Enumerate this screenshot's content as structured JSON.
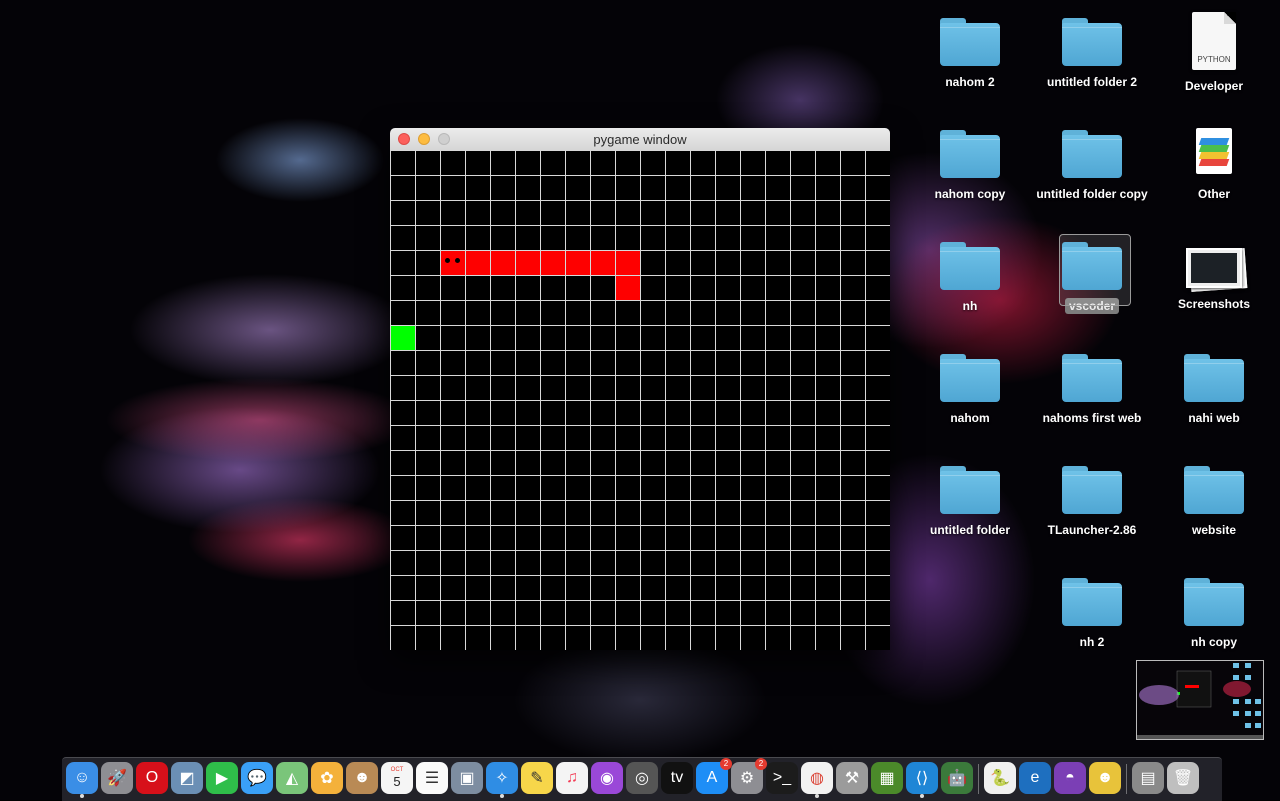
{
  "window": {
    "title": "pygame window"
  },
  "game": {
    "grid_columns": 20,
    "grid_rows": 20,
    "snake_color": "#fe0000",
    "food_color": "#00ff00",
    "grid_line_color": "#d8d8d8",
    "board_background": "#000000",
    "snake_segments": [
      [
        2,
        4
      ],
      [
        3,
        4
      ],
      [
        4,
        4
      ],
      [
        5,
        4
      ],
      [
        6,
        4
      ],
      [
        7,
        4
      ],
      [
        8,
        4
      ],
      [
        9,
        4
      ],
      [
        9,
        5
      ]
    ],
    "snake_head": [
      2,
      4
    ],
    "food": [
      0,
      7
    ]
  },
  "desktop": {
    "icons": [
      {
        "label": "nahom 2",
        "type": "folder"
      },
      {
        "label": "untitled folder 2",
        "type": "folder"
      },
      {
        "label": "Developer",
        "type": "document",
        "doc_text": "PYTHON"
      },
      {
        "label": "nahom copy",
        "type": "folder"
      },
      {
        "label": "untitled folder copy",
        "type": "folder"
      },
      {
        "label": "Other",
        "type": "stack"
      },
      {
        "label": "nh",
        "type": "folder"
      },
      {
        "label": "vscoder",
        "type": "folder",
        "selected": true
      },
      {
        "label": "Screenshots",
        "type": "screenshots"
      },
      {
        "label": "nahom",
        "type": "folder"
      },
      {
        "label": "nahoms first web",
        "type": "folder"
      },
      {
        "label": "nahi web",
        "type": "folder"
      },
      {
        "label": "untitled folder",
        "type": "folder"
      },
      {
        "label": "TLauncher-2.86",
        "type": "folder"
      },
      {
        "label": "website",
        "type": "folder"
      },
      {
        "label": "nh 2",
        "type": "folder"
      },
      {
        "label": "nh copy",
        "type": "folder"
      }
    ]
  },
  "dock": {
    "apps": [
      {
        "name": "finder-icon",
        "glyph": "☺",
        "color": "#3a8ee6",
        "running": true
      },
      {
        "name": "launchpad-icon",
        "glyph": "🚀",
        "color": "#8e8e93"
      },
      {
        "name": "opera-icon",
        "glyph": "O",
        "color": "#d7101a"
      },
      {
        "name": "preview-icon",
        "glyph": "◩",
        "color": "#6b8fb5"
      },
      {
        "name": "facetime-icon",
        "glyph": "▶",
        "color": "#2fbe4a"
      },
      {
        "name": "messages-icon",
        "glyph": "💬",
        "color": "#3aa0f7"
      },
      {
        "name": "maps-icon",
        "glyph": "◭",
        "color": "#7ac57a"
      },
      {
        "name": "photos-icon",
        "glyph": "✿",
        "color": "#f4b13b"
      },
      {
        "name": "contacts-icon",
        "glyph": "☻",
        "color": "#b98a55"
      },
      {
        "name": "calendar-icon",
        "glyph": "5",
        "color": "#f5f5f5",
        "text_color": "#222",
        "caption": "OCT"
      },
      {
        "name": "reminders-icon",
        "glyph": "☰",
        "color": "#fafafa",
        "text_color": "#333"
      },
      {
        "name": "image-capture-icon",
        "glyph": "▣",
        "color": "#7d8da1"
      },
      {
        "name": "safari-icon",
        "glyph": "✧",
        "color": "#2f8de4",
        "running": true
      },
      {
        "name": "notes-icon",
        "glyph": "✎",
        "color": "#f7d64a",
        "text_color": "#333"
      },
      {
        "name": "music-icon",
        "glyph": "♫",
        "color": "#f4f4f4",
        "text_color": "#f33b55"
      },
      {
        "name": "podcasts-icon",
        "glyph": "◉",
        "color": "#9a48d8"
      },
      {
        "name": "screenshot-icon",
        "glyph": "◎",
        "color": "#555"
      },
      {
        "name": "apple-tv-icon",
        "glyph": "tv",
        "color": "#111"
      },
      {
        "name": "app-store-icon",
        "glyph": "A",
        "color": "#1e8ef6",
        "badge": "2"
      },
      {
        "name": "system-preferences-icon",
        "glyph": "⚙",
        "color": "#8e8e93",
        "badge": "2"
      },
      {
        "name": "terminal-icon",
        "glyph": ">_",
        "color": "#1c1c1c"
      },
      {
        "name": "chrome-icon",
        "glyph": "◍",
        "color": "#f2f2f2",
        "text_color": "#db4437",
        "running": true
      },
      {
        "name": "automator-icon",
        "glyph": "⚒",
        "color": "#9b9b9b"
      },
      {
        "name": "minecraft-icon",
        "glyph": "▦",
        "color": "#4b8a2a"
      },
      {
        "name": "vscode-icon",
        "glyph": "⟨⟩",
        "color": "#1f86d6",
        "running": true
      },
      {
        "name": "android-icon",
        "glyph": "🤖",
        "color": "#3b7a3b"
      },
      {
        "name": "python-launcher-icon",
        "glyph": "🐍",
        "color": "#f0f0f0"
      },
      {
        "name": "edge-icon",
        "glyph": "e",
        "color": "#1e6fbf"
      },
      {
        "name": "purple-app-icon",
        "glyph": "◓",
        "color": "#7b3fb5"
      },
      {
        "name": "cyberduck-icon",
        "glyph": "☻",
        "color": "#e8c33a"
      },
      {
        "name": "downloads-stack-icon",
        "glyph": "▤",
        "color": "#8a8a8a"
      },
      {
        "name": "trash-icon",
        "glyph": "🗑",
        "color": "#bfbfbf"
      }
    ]
  }
}
